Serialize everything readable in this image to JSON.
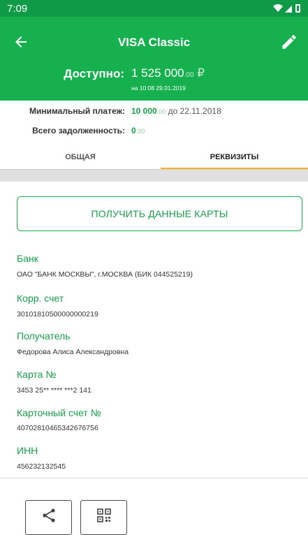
{
  "status_bar": {
    "time": "7:09"
  },
  "header": {
    "title": "VISA Classic",
    "available_label": "Доступно:",
    "available_int": "1 525 000",
    "available_kop": ".00",
    "currency": "₽",
    "available_date": "на 10:08 29.01.2019"
  },
  "info": {
    "min_payment_label": "Минимальный платеж:",
    "min_payment_int": "10 000",
    "min_payment_kop": ".00",
    "min_payment_due": "до 22.11.2018",
    "total_debt_label": "Всего задолженность:",
    "total_debt_int": "0",
    "total_debt_kop": ".00"
  },
  "tabs": {
    "general": "ОБЩАЯ",
    "details": "РЕКВИЗИТЫ",
    "active": "details"
  },
  "get_card_button": "ПОЛУЧИТЬ ДАННЫЕ КАРТЫ",
  "fields": [
    {
      "label": "Банк",
      "value": "ОАО \"БАНК МОСКВЫ\", г.МОСКВА (БИК 044525219)"
    },
    {
      "label": "Корр. счет",
      "value": "30101810500000000219"
    },
    {
      "label": "Получатель",
      "value": "Федорова Алиса Александровна"
    },
    {
      "label": "Карта №",
      "value": "3453 25** **** ***2 141"
    },
    {
      "label": "Карточный счет №",
      "value": "40702810465342676756"
    },
    {
      "label": "ИНН",
      "value": "456232132545"
    }
  ],
  "actions": [
    {
      "icon": "share-icon"
    },
    {
      "icon": "qr-code-icon"
    }
  ],
  "colors": {
    "header_green": "#16b04f",
    "status_green": "#0f9a48",
    "accent_green": "#16a04a",
    "tab_underline": "#f6b31f"
  }
}
